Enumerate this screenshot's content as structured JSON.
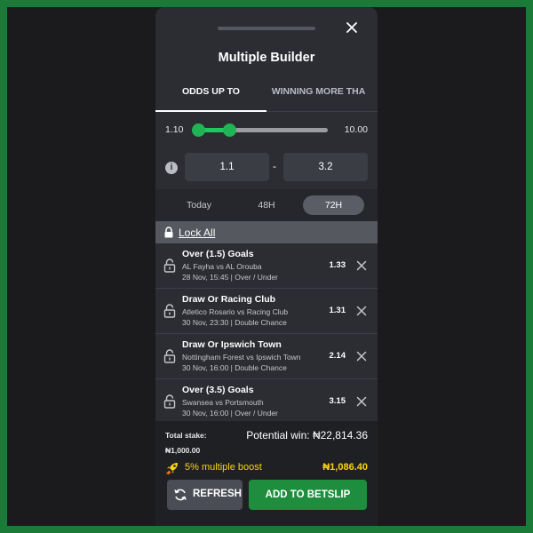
{
  "header": {
    "title": "Multiple Builder"
  },
  "tabs": [
    {
      "label": "ODDS UP TO"
    },
    {
      "label": "WINNING MORE THA"
    }
  ],
  "slider": {
    "min_label": "1.10",
    "max_label": "10.00",
    "low_fraction": 0.0,
    "high_fraction": 0.24
  },
  "range": {
    "from": "1.1",
    "separator": "-",
    "to": "3.2"
  },
  "time_filters": [
    {
      "label": "Today"
    },
    {
      "label": "48H"
    },
    {
      "label": "72H"
    }
  ],
  "lock_all": {
    "label": "Lock All"
  },
  "selections": [
    {
      "market": "Over (1.5) Goals",
      "teams": "AL Fayha vs AL Orouba",
      "meta": "28 Nov, 15:45 | Over / Under",
      "odds": "1.33"
    },
    {
      "market": "Draw Or Racing Club",
      "teams": "Atletico Rosario vs Racing Club",
      "meta": "30 Nov, 23:30 | Double Chance",
      "odds": "1.31"
    },
    {
      "market": "Draw Or Ipswich Town",
      "teams": "Nottingham Forest vs Ipswich Town",
      "meta": "30 Nov, 16:00 | Double Chance",
      "odds": "2.14"
    },
    {
      "market": "Over (3.5) Goals",
      "teams": "Swansea vs Portsmouth",
      "meta": "30 Nov, 16:00 | Over / Under",
      "odds": "3.15"
    }
  ],
  "footer": {
    "stake_label": "Total stake:",
    "stake_value": "₦1,000.00",
    "potential_label": "Potential win:",
    "potential_value": "₦22,814.36",
    "boost_label": "5% multiple boost",
    "boost_value": "₦1,086.40",
    "refresh_label": "REFRESH",
    "betslip_label": "ADD TO BETSLIP"
  },
  "colors": {
    "accent": "#22c55e",
    "boost": "#f5d70f",
    "cta": "#1e8e3e",
    "frame": "#1c7a38"
  }
}
